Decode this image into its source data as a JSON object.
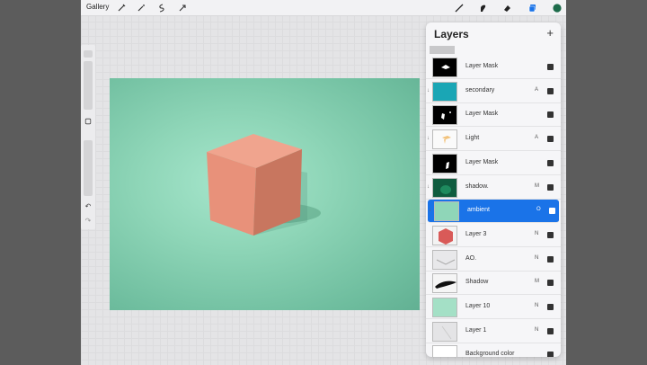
{
  "topbar": {
    "gallery_label": "Gallery",
    "icons": [
      "wrench-icon",
      "magic-wand-icon",
      "selection-icon",
      "transform-icon",
      "brush-icon",
      "smudge-icon",
      "eraser-icon",
      "layers-icon",
      "color-icon"
    ],
    "active_color": "#1d6b4a"
  },
  "layers": {
    "title": "Layers",
    "add_label": "+",
    "items": [
      {
        "name": "Layer Mask",
        "mode": "",
        "clipped": false,
        "thumb": "mask1"
      },
      {
        "name": "secondary",
        "mode": "A",
        "clipped": true,
        "thumb": "teal"
      },
      {
        "name": "Layer Mask",
        "mode": "",
        "clipped": false,
        "thumb": "mask2"
      },
      {
        "name": "Light",
        "mode": "A",
        "clipped": true,
        "thumb": "light"
      },
      {
        "name": "Layer Mask",
        "mode": "",
        "clipped": false,
        "thumb": "mask3"
      },
      {
        "name": "shadow.",
        "mode": "M",
        "clipped": true,
        "thumb": "shadowdark"
      },
      {
        "name": "ambient",
        "mode": "O",
        "clipped": true,
        "thumb": "ambient",
        "selected": true
      },
      {
        "name": "Layer 3",
        "mode": "N",
        "clipped": false,
        "thumb": "hex"
      },
      {
        "name": "AO.",
        "mode": "N",
        "clipped": false,
        "thumb": "ao"
      },
      {
        "name": "Shadow",
        "mode": "M",
        "clipped": false,
        "thumb": "brush"
      },
      {
        "name": "Layer 10",
        "mode": "N",
        "clipped": false,
        "thumb": "mint"
      },
      {
        "name": "Layer 1",
        "mode": "N",
        "clipped": false,
        "thumb": "light-grey"
      },
      {
        "name": "Background color",
        "mode": "",
        "clipped": false,
        "thumb": "white"
      }
    ]
  },
  "colors": {
    "selected_row": "#1a73e8",
    "canvas_bg": "#8fd6b8",
    "cube": "#e79176"
  }
}
